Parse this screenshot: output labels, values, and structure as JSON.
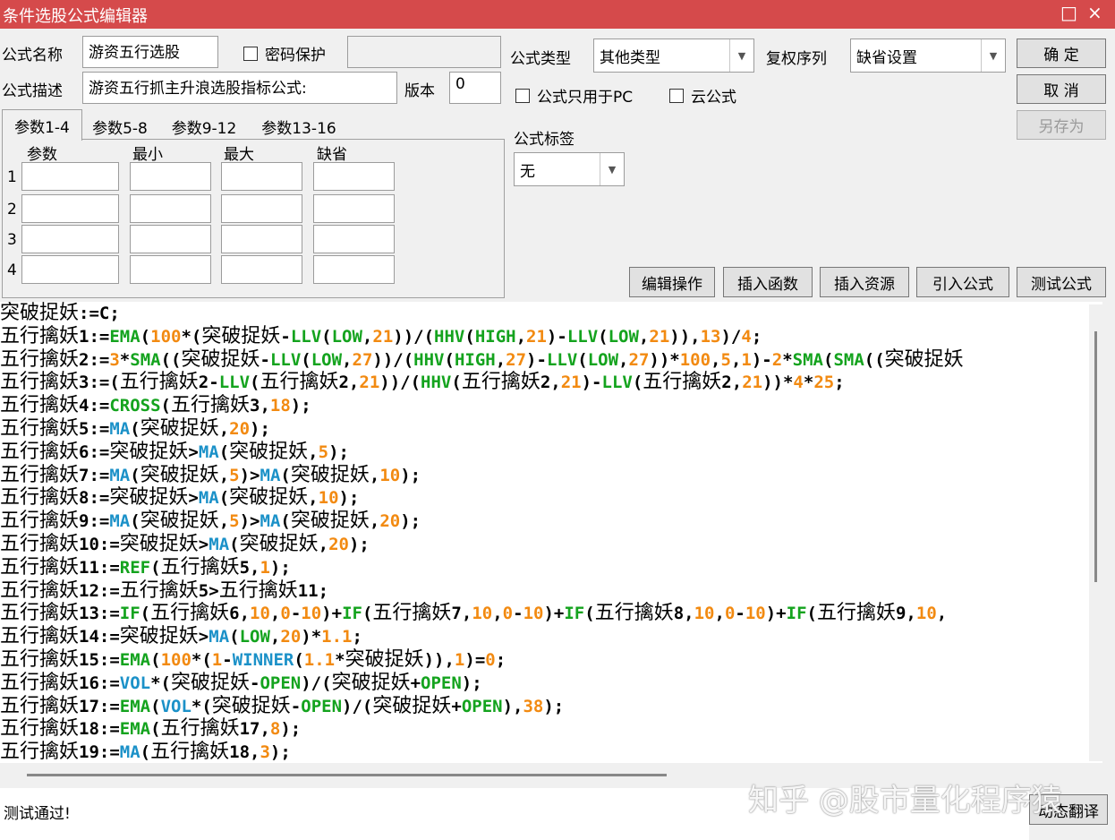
{
  "window": {
    "title": "条件选股公式编辑器",
    "controls": {
      "maximize": "□",
      "close": "×"
    }
  },
  "form": {
    "name_label": "公式名称",
    "name_value": "游资五行选股",
    "password_label": "密码保护",
    "desc_label": "公式描述",
    "desc_value": "游资五行抓主升浪选股指标公式:",
    "version_label": "版本",
    "version_value": "0",
    "type_label": "公式类型",
    "type_value": "其他类型",
    "rights_label": "复权序列",
    "rights_value": "缺省设置",
    "pc_only_label": "公式只用于PC",
    "cloud_label": "云公式",
    "tag_label": "公式标签",
    "tag_value": "无"
  },
  "buttons": {
    "ok": "确  定",
    "cancel": "取  消",
    "save_as": "另存为",
    "edit_ops": "编辑操作",
    "insert_func": "插入函数",
    "insert_res": "插入资源",
    "import_formula": "引入公式",
    "test_formula": "测试公式",
    "dynamic_translate": "动态翻译"
  },
  "params": {
    "tabs": [
      "参数1-4",
      "参数5-8",
      "参数9-12",
      "参数13-16"
    ],
    "headers": [
      "参数",
      "最小",
      "最大",
      "缺省"
    ],
    "rows": [
      "1",
      "2",
      "3",
      "4"
    ]
  },
  "code_lines": [
    [
      [
        "cn",
        "突破捉妖"
      ],
      [
        "",
        "​:=C;"
      ]
    ],
    [
      [
        "cn",
        "五行擒妖"
      ],
      [
        "",
        "1:="
      ],
      [
        "gn",
        "EMA"
      ],
      [
        "",
        "("
      ],
      [
        "nm",
        "100"
      ],
      [
        "",
        "*("
      ],
      [
        "cn",
        "突破捉妖"
      ],
      [
        "",
        "-"
      ],
      [
        "gn",
        "LLV"
      ],
      [
        "",
        "("
      ],
      [
        "gn",
        "LOW"
      ],
      [
        "",
        ","
      ],
      [
        "nm",
        "21"
      ],
      [
        "",
        "))/("
      ],
      [
        "gn",
        "HHV"
      ],
      [
        "",
        "("
      ],
      [
        "gn",
        "HIGH"
      ],
      [
        "",
        ","
      ],
      [
        "nm",
        "21"
      ],
      [
        "",
        ")-"
      ],
      [
        "gn",
        "LLV"
      ],
      [
        "",
        "("
      ],
      [
        "gn",
        "LOW"
      ],
      [
        "",
        ","
      ],
      [
        "nm",
        "21"
      ],
      [
        "",
        ")),"
      ],
      [
        "nm",
        "13"
      ],
      [
        "",
        ")/"
      ],
      [
        "nm",
        "4"
      ],
      [
        "",
        ";"
      ]
    ],
    [
      [
        "cn",
        "五行擒妖"
      ],
      [
        "",
        "2:="
      ],
      [
        "nm",
        "3"
      ],
      [
        "",
        "*"
      ],
      [
        "gn",
        "SMA"
      ],
      [
        "",
        "(("
      ],
      [
        "cn",
        "突破捉妖"
      ],
      [
        "",
        "-"
      ],
      [
        "gn",
        "LLV"
      ],
      [
        "",
        "("
      ],
      [
        "gn",
        "LOW"
      ],
      [
        "",
        ","
      ],
      [
        "nm",
        "27"
      ],
      [
        "",
        "))/("
      ],
      [
        "gn",
        "HHV"
      ],
      [
        "",
        "("
      ],
      [
        "gn",
        "HIGH"
      ],
      [
        "",
        ","
      ],
      [
        "nm",
        "27"
      ],
      [
        "",
        ")-"
      ],
      [
        "gn",
        "LLV"
      ],
      [
        "",
        "("
      ],
      [
        "gn",
        "LOW"
      ],
      [
        "",
        ","
      ],
      [
        "nm",
        "27"
      ],
      [
        "",
        "))*"
      ],
      [
        "nm",
        "100"
      ],
      [
        "",
        ","
      ],
      [
        "nm",
        "5"
      ],
      [
        "",
        ","
      ],
      [
        "nm",
        "1"
      ],
      [
        "",
        ")-"
      ],
      [
        "nm",
        "2"
      ],
      [
        "",
        "*"
      ],
      [
        "gn",
        "SMA"
      ],
      [
        "",
        "("
      ],
      [
        "gn",
        "SMA"
      ],
      [
        "",
        "(("
      ],
      [
        "cn",
        "突破捉妖"
      ]
    ],
    [
      [
        "cn",
        "五行擒妖"
      ],
      [
        "",
        "3:=("
      ],
      [
        "cn",
        "五行擒妖"
      ],
      [
        "",
        "2-"
      ],
      [
        "gn",
        "LLV"
      ],
      [
        "",
        "("
      ],
      [
        "cn",
        "五行擒妖"
      ],
      [
        "",
        "2,"
      ],
      [
        "nm",
        "21"
      ],
      [
        "",
        "))/("
      ],
      [
        "gn",
        "HHV"
      ],
      [
        "",
        "("
      ],
      [
        "cn",
        "五行擒妖"
      ],
      [
        "",
        "2,"
      ],
      [
        "nm",
        "21"
      ],
      [
        "",
        ")-"
      ],
      [
        "gn",
        "LLV"
      ],
      [
        "",
        "("
      ],
      [
        "cn",
        "五行擒妖"
      ],
      [
        "",
        "2,"
      ],
      [
        "nm",
        "21"
      ],
      [
        "",
        "))*"
      ],
      [
        "nm",
        "4"
      ],
      [
        "",
        "*"
      ],
      [
        "nm",
        "25"
      ],
      [
        "",
        ";"
      ]
    ],
    [
      [
        "cn",
        "五行擒妖"
      ],
      [
        "",
        "4:="
      ],
      [
        "gn",
        "CROSS"
      ],
      [
        "",
        "("
      ],
      [
        "cn",
        "五行擒妖"
      ],
      [
        "",
        "3,"
      ],
      [
        "nm",
        "18"
      ],
      [
        "",
        ");"
      ]
    ],
    [
      [
        "cn",
        "五行擒妖"
      ],
      [
        "",
        "5:="
      ],
      [
        "fn",
        "MA"
      ],
      [
        "",
        "("
      ],
      [
        "cn",
        "突破捉妖"
      ],
      [
        "",
        ","
      ],
      [
        "nm",
        "20"
      ],
      [
        "",
        ");"
      ]
    ],
    [
      [
        "cn",
        "五行擒妖"
      ],
      [
        "",
        "6:="
      ],
      [
        "cn",
        "突破捉妖"
      ],
      [
        "",
        ">"
      ],
      [
        "fn",
        "MA"
      ],
      [
        "",
        "("
      ],
      [
        "cn",
        "突破捉妖"
      ],
      [
        "",
        ","
      ],
      [
        "nm",
        "5"
      ],
      [
        "",
        ");"
      ]
    ],
    [
      [
        "cn",
        "五行擒妖"
      ],
      [
        "",
        "7:="
      ],
      [
        "fn",
        "MA"
      ],
      [
        "",
        "("
      ],
      [
        "cn",
        "突破捉妖"
      ],
      [
        "",
        ","
      ],
      [
        "nm",
        "5"
      ],
      [
        "",
        ")>"
      ],
      [
        "fn",
        "MA"
      ],
      [
        "",
        "("
      ],
      [
        "cn",
        "突破捉妖"
      ],
      [
        "",
        ","
      ],
      [
        "nm",
        "10"
      ],
      [
        "",
        ");"
      ]
    ],
    [
      [
        "cn",
        "五行擒妖"
      ],
      [
        "",
        "8:="
      ],
      [
        "cn",
        "突破捉妖"
      ],
      [
        "",
        ">"
      ],
      [
        "fn",
        "MA"
      ],
      [
        "",
        "("
      ],
      [
        "cn",
        "突破捉妖"
      ],
      [
        "",
        ","
      ],
      [
        "nm",
        "10"
      ],
      [
        "",
        ");"
      ]
    ],
    [
      [
        "cn",
        "五行擒妖"
      ],
      [
        "",
        "9:="
      ],
      [
        "fn",
        "MA"
      ],
      [
        "",
        "("
      ],
      [
        "cn",
        "突破捉妖"
      ],
      [
        "",
        ","
      ],
      [
        "nm",
        "5"
      ],
      [
        "",
        ")>"
      ],
      [
        "fn",
        "MA"
      ],
      [
        "",
        "("
      ],
      [
        "cn",
        "突破捉妖"
      ],
      [
        "",
        ","
      ],
      [
        "nm",
        "20"
      ],
      [
        "",
        ");"
      ]
    ],
    [
      [
        "cn",
        "五行擒妖"
      ],
      [
        "",
        "10:="
      ],
      [
        "cn",
        "突破捉妖"
      ],
      [
        "",
        ">"
      ],
      [
        "fn",
        "MA"
      ],
      [
        "",
        "("
      ],
      [
        "cn",
        "突破捉妖"
      ],
      [
        "",
        ","
      ],
      [
        "nm",
        "20"
      ],
      [
        "",
        ");"
      ]
    ],
    [
      [
        "cn",
        "五行擒妖"
      ],
      [
        "",
        "11:="
      ],
      [
        "gn",
        "REF"
      ],
      [
        "",
        "("
      ],
      [
        "cn",
        "五行擒妖"
      ],
      [
        "",
        "5,"
      ],
      [
        "nm",
        "1"
      ],
      [
        "",
        ");"
      ]
    ],
    [
      [
        "cn",
        "五行擒妖"
      ],
      [
        "",
        "12:="
      ],
      [
        "cn",
        "五行擒妖"
      ],
      [
        "",
        "5>"
      ],
      [
        "cn",
        "五行擒妖"
      ],
      [
        "",
        "11;"
      ]
    ],
    [
      [
        "cn",
        "五行擒妖"
      ],
      [
        "",
        "13:="
      ],
      [
        "gn",
        "IF"
      ],
      [
        "",
        "("
      ],
      [
        "cn",
        "五行擒妖"
      ],
      [
        "",
        "6,"
      ],
      [
        "nm",
        "10"
      ],
      [
        "",
        ","
      ],
      [
        "nm",
        "0"
      ],
      [
        "",
        "-"
      ],
      [
        "nm",
        "10"
      ],
      [
        "",
        ")+"
      ],
      [
        "gn",
        "IF"
      ],
      [
        "",
        "("
      ],
      [
        "cn",
        "五行擒妖"
      ],
      [
        "",
        "7,"
      ],
      [
        "nm",
        "10"
      ],
      [
        "",
        ","
      ],
      [
        "nm",
        "0"
      ],
      [
        "",
        "-"
      ],
      [
        "nm",
        "10"
      ],
      [
        "",
        ")+"
      ],
      [
        "gn",
        "IF"
      ],
      [
        "",
        "("
      ],
      [
        "cn",
        "五行擒妖"
      ],
      [
        "",
        "8,"
      ],
      [
        "nm",
        "10"
      ],
      [
        "",
        ","
      ],
      [
        "nm",
        "0"
      ],
      [
        "",
        "-"
      ],
      [
        "nm",
        "10"
      ],
      [
        "",
        ")+"
      ],
      [
        "gn",
        "IF"
      ],
      [
        "",
        "("
      ],
      [
        "cn",
        "五行擒妖"
      ],
      [
        "",
        "9,"
      ],
      [
        "nm",
        "10"
      ],
      [
        "",
        ","
      ]
    ],
    [
      [
        "cn",
        "五行擒妖"
      ],
      [
        "",
        "14:="
      ],
      [
        "cn",
        "突破捉妖"
      ],
      [
        "",
        ">"
      ],
      [
        "fn",
        "MA"
      ],
      [
        "",
        "("
      ],
      [
        "gn",
        "LOW"
      ],
      [
        "",
        ","
      ],
      [
        "nm",
        "20"
      ],
      [
        "",
        ")*"
      ],
      [
        "nm",
        "1.1"
      ],
      [
        "",
        ";"
      ]
    ],
    [
      [
        "cn",
        "五行擒妖"
      ],
      [
        "",
        "15:="
      ],
      [
        "gn",
        "EMA"
      ],
      [
        "",
        "("
      ],
      [
        "nm",
        "100"
      ],
      [
        "",
        "*("
      ],
      [
        "nm",
        "1"
      ],
      [
        "",
        "-"
      ],
      [
        "fn",
        "WINNER"
      ],
      [
        "",
        "("
      ],
      [
        "nm",
        "1.1"
      ],
      [
        "",
        "*"
      ],
      [
        "cn",
        "突破捉妖"
      ],
      [
        "",
        "))"
      ],
      [
        "",
        ","
      ],
      [
        "nm",
        "1"
      ],
      [
        "",
        ")="
      ],
      [
        "nm",
        "0"
      ],
      [
        "",
        ";"
      ]
    ],
    [
      [
        "cn",
        "五行擒妖"
      ],
      [
        "",
        "16:="
      ],
      [
        "fn",
        "VOL"
      ],
      [
        "",
        "*("
      ],
      [
        "cn",
        "突破捉妖"
      ],
      [
        "",
        "-"
      ],
      [
        "gn",
        "OPEN"
      ],
      [
        "",
        ")/("
      ],
      [
        "cn",
        "突破捉妖"
      ],
      [
        "",
        "+"
      ],
      [
        "gn",
        "OPEN"
      ],
      [
        "",
        ");"
      ]
    ],
    [
      [
        "cn",
        "五行擒妖"
      ],
      [
        "",
        "17:="
      ],
      [
        "gn",
        "EMA"
      ],
      [
        "",
        "("
      ],
      [
        "fn",
        "VOL"
      ],
      [
        "",
        "*("
      ],
      [
        "cn",
        "突破捉妖"
      ],
      [
        "",
        "-"
      ],
      [
        "gn",
        "OPEN"
      ],
      [
        "",
        ")/("
      ],
      [
        "cn",
        "突破捉妖"
      ],
      [
        "",
        "+"
      ],
      [
        "gn",
        "OPEN"
      ],
      [
        "",
        "),"
      ],
      [
        "nm",
        "38"
      ],
      [
        "",
        ");"
      ]
    ],
    [
      [
        "cn",
        "五行擒妖"
      ],
      [
        "",
        "18:="
      ],
      [
        "gn",
        "EMA"
      ],
      [
        "",
        "("
      ],
      [
        "cn",
        "五行擒妖"
      ],
      [
        "",
        "17,"
      ],
      [
        "nm",
        "8"
      ],
      [
        "",
        ");"
      ]
    ],
    [
      [
        "cn",
        "五行擒妖"
      ],
      [
        "",
        "19:="
      ],
      [
        "fn",
        "MA"
      ],
      [
        "",
        "("
      ],
      [
        "cn",
        "五行擒妖"
      ],
      [
        "",
        "18,"
      ],
      [
        "nm",
        "3"
      ],
      [
        "",
        ");"
      ]
    ]
  ],
  "status": {
    "message": "测试通过!"
  },
  "watermark": "知乎 @股市量化程序猿"
}
